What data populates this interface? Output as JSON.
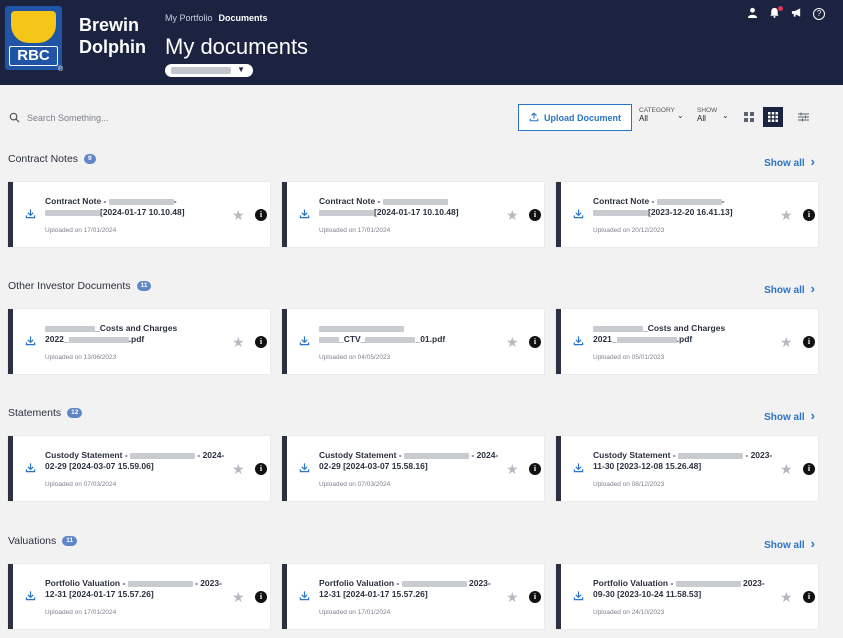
{
  "brand": {
    "line1": "Brewin",
    "line2": "Dolphin",
    "logo_text": "RBC",
    "registered": "®"
  },
  "breadcrumb": {
    "parent": "My Portfolio",
    "current": "Documents"
  },
  "page_title": "My documents",
  "toolbar": {
    "search_placeholder": "Search Something...",
    "upload_label": "Upload Document",
    "category_label": "CATEGORY",
    "category_value": "All",
    "show_label": "SHOW",
    "show_value": "All"
  },
  "sections": [
    {
      "title": "Contract Notes",
      "count": "9",
      "show_all": "Show all",
      "cards": [
        {
          "line1a": "Contract Note - ",
          "line1b": "-",
          "line2": "[2024-01-17 10.10.48]",
          "uploaded": "Uploaded on 17/01/2024"
        },
        {
          "line1a": "Contract Note - ",
          "line1b": "",
          "line2": "[2024-01-17 10.10.48]",
          "uploaded": "Uploaded on 17/01/2024"
        },
        {
          "line1a": "Contract Note - ",
          "line1b": "-",
          "line2": "[2023-12-20 16.41.13]",
          "uploaded": "Uploaded on 20/12/2023"
        }
      ]
    },
    {
      "title": "Other Investor Documents",
      "count": "11",
      "show_all": "Show all",
      "cards": [
        {
          "line1a": "",
          "line1b": "_Costs and Charges",
          "line2": "2022_",
          "line2b": ".pdf",
          "uploaded": "Uploaded on 13/06/2023"
        },
        {
          "line1a": "",
          "line1b": "",
          "line2": "_CTV_",
          "line2b": "_01.pdf",
          "uploaded": "Uploaded on 04/05/2023"
        },
        {
          "line1a": "",
          "line1b": "_Costs and Charges",
          "line2": "2021_",
          "line2b": ".pdf",
          "uploaded": "Uploaded on 05/01/2023"
        }
      ]
    },
    {
      "title": "Statements",
      "count": "12",
      "show_all": "Show all",
      "cards": [
        {
          "line1a": "Custody Statement - ",
          "line1b": " - 2024-",
          "line2": "02-29 [2024-03-07 15.59.06]",
          "uploaded": "Uploaded on 07/03/2024"
        },
        {
          "line1a": "Custody Statement - ",
          "line1b": " - 2024-",
          "line2": "02-29 [2024-03-07 15.58.16]",
          "uploaded": "Uploaded on 07/03/2024"
        },
        {
          "line1a": "Custody Statement - ",
          "line1b": " - 2023-",
          "line2": "11-30 [2023-12-08 15.26.48]",
          "uploaded": "Uploaded on 08/12/2023"
        }
      ]
    },
    {
      "title": "Valuations",
      "count": "11",
      "show_all": "Show all",
      "cards": [
        {
          "line1a": "Portfolio Valuation - ",
          "line1b": " - 2023-",
          "line2": "12-31 [2024-01-17 15.57.26]",
          "uploaded": "Uploaded on 17/01/2024"
        },
        {
          "line1a": "Portfolio Valuation - ",
          "line1b": " 2023-",
          "line2": "12-31 [2024-01-17 15.57.26]",
          "uploaded": "Uploaded on 17/01/2024"
        },
        {
          "line1a": "Portfolio Valuation - ",
          "line1b": " 2023-",
          "line2": "09-30 [2023-10-24 11.58.53]",
          "uploaded": "Uploaded on 24/10/2023"
        }
      ]
    }
  ],
  "icons": {
    "search": "search-icon",
    "upload": "upload-icon",
    "download": "download-icon",
    "star": "star-icon",
    "info": "info-icon",
    "user": "user-icon",
    "bell": "bell-icon",
    "megaphone": "megaphone-icon",
    "help": "help-icon"
  },
  "colors": {
    "header_bg": "#1b2340",
    "accent": "#2a74c8",
    "badge": "#5f87c8",
    "page_bg": "#f2f2f2"
  }
}
